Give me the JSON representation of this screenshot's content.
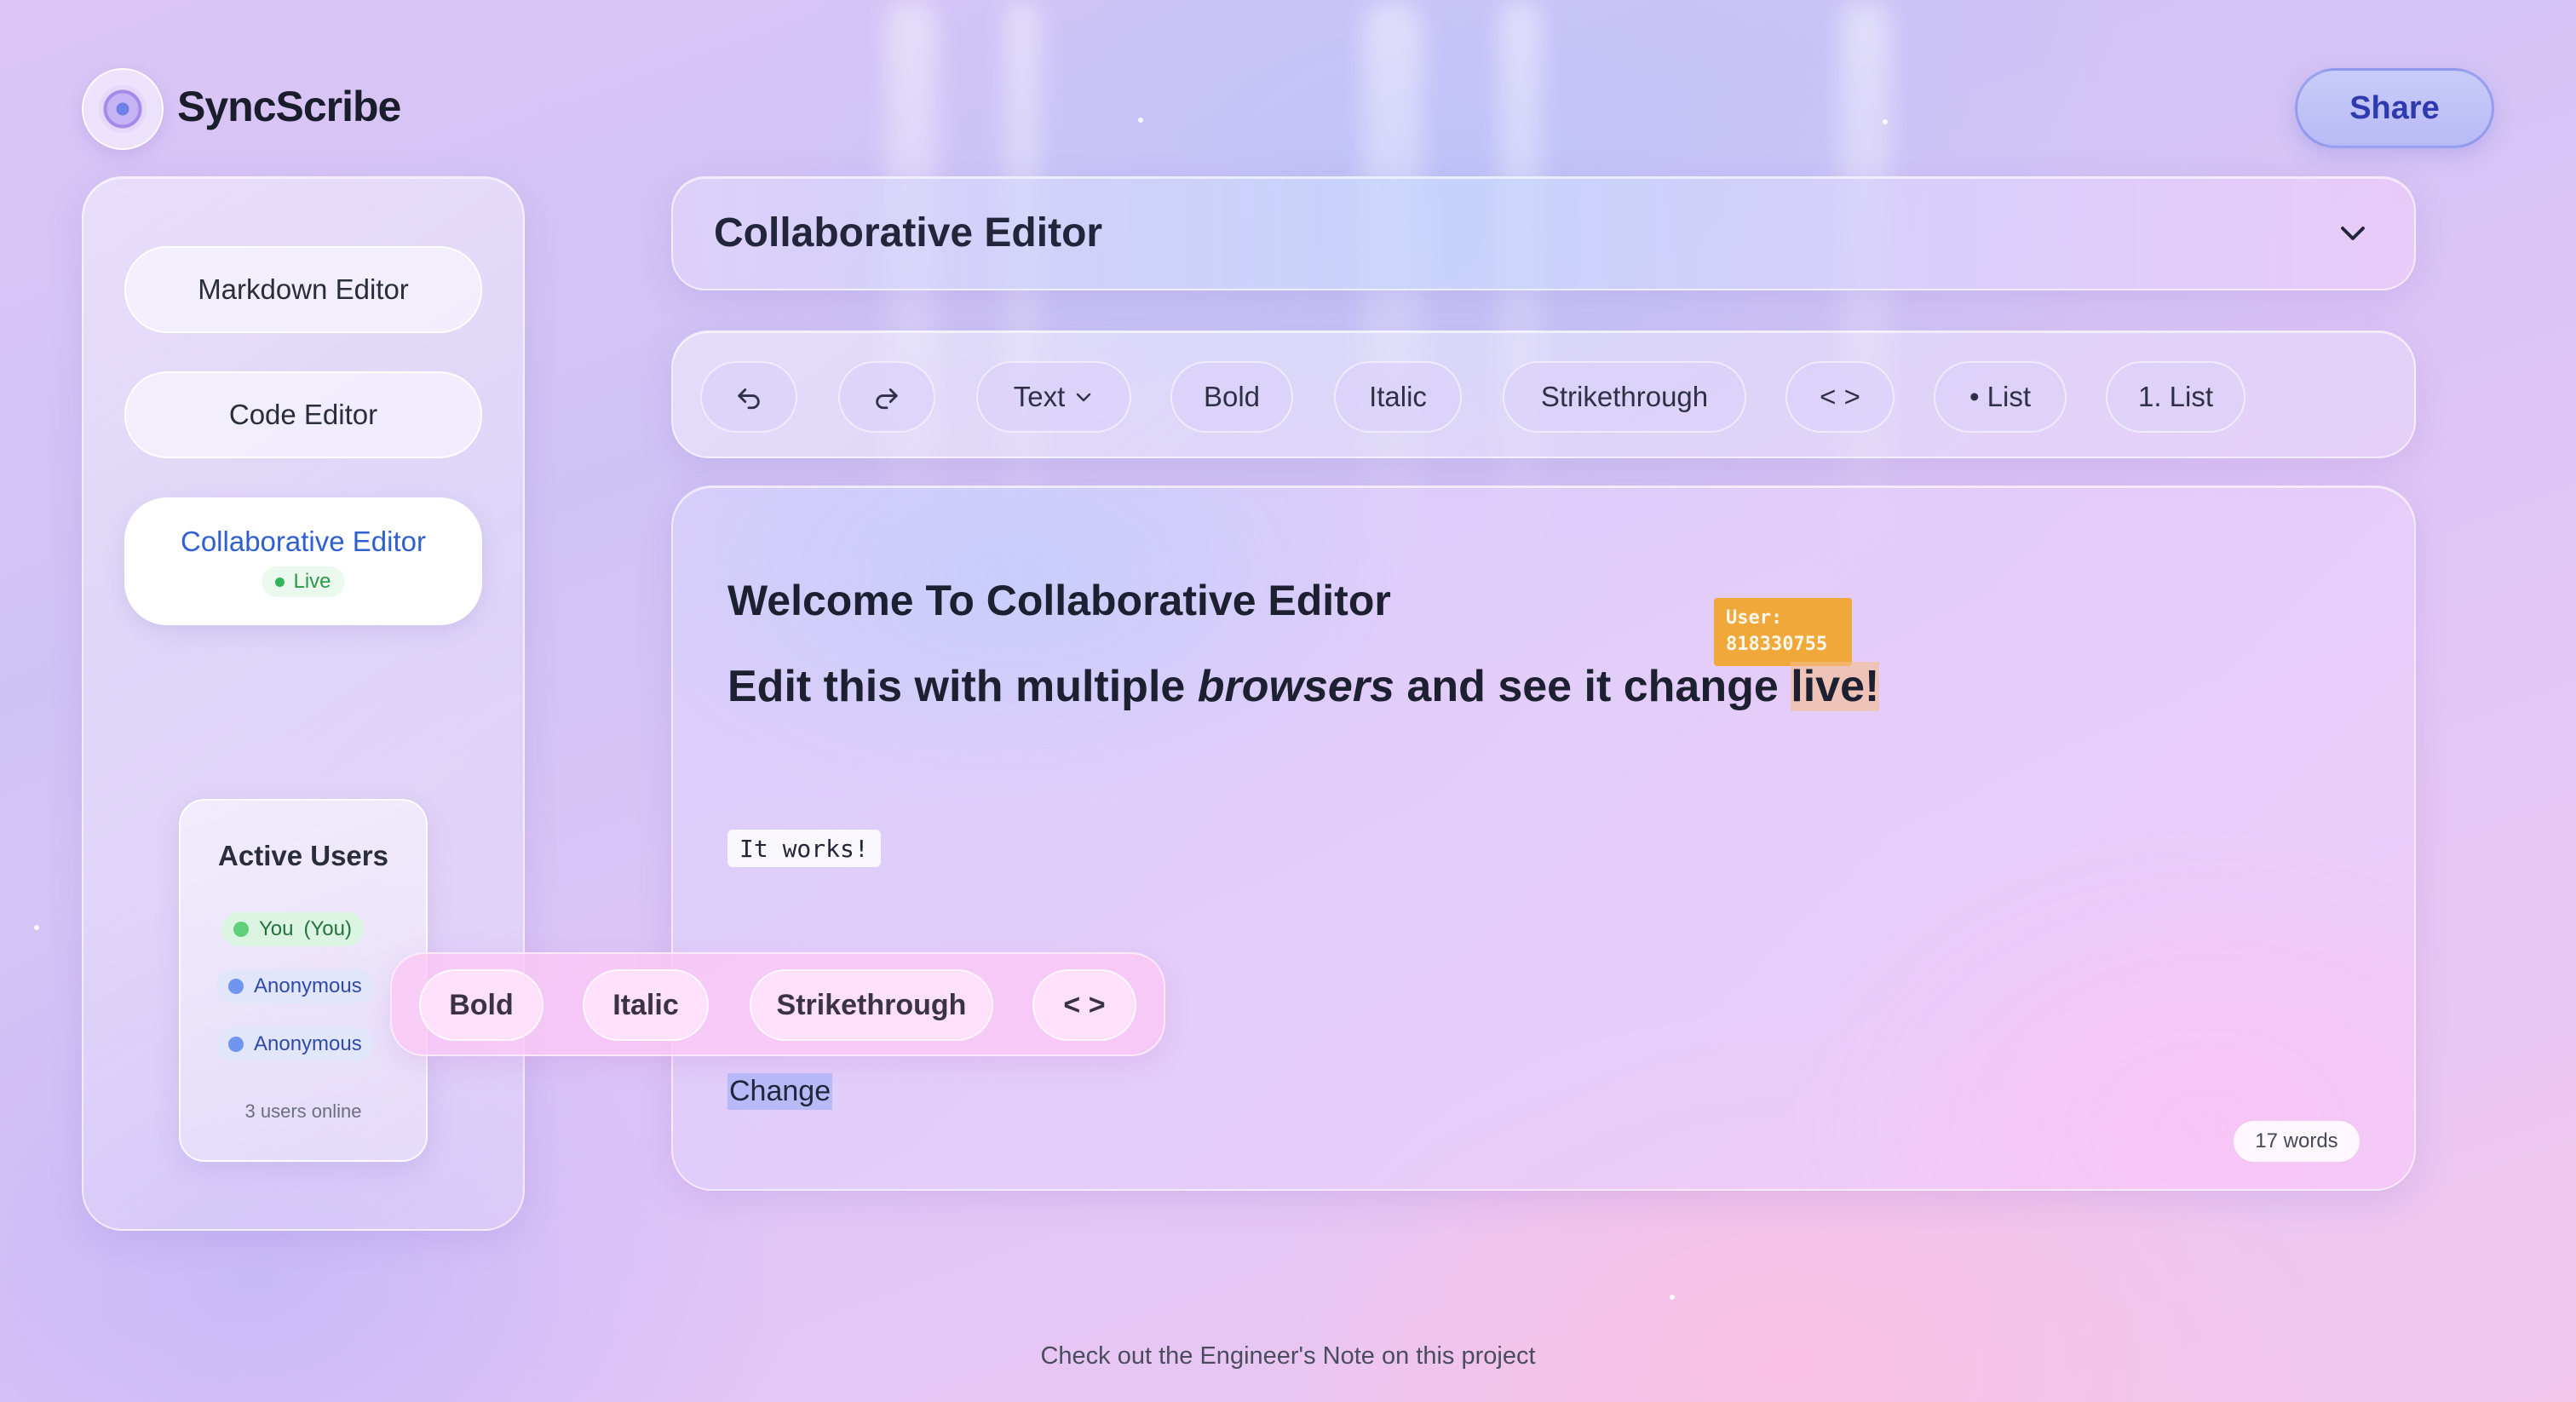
{
  "app": {
    "brand": "SyncScribe",
    "share_label": "Share"
  },
  "sidebar": {
    "items": [
      {
        "label": "Markdown Editor"
      },
      {
        "label": "Code Editor"
      },
      {
        "label": "Collaborative Editor",
        "badge": "Live",
        "active": true
      }
    ],
    "active_users": {
      "title": "Active Users",
      "users": [
        {
          "name": "You",
          "suffix": "(You)",
          "color": "#5fcf7a"
        },
        {
          "name": "Anonymous",
          "color": "#6f95ee"
        },
        {
          "name": "Anonymous",
          "color": "#6f95ee"
        }
      ],
      "footer": "3 users online"
    }
  },
  "main": {
    "title": "Collaborative Editor",
    "toolbar": {
      "undo_icon": "undo-icon",
      "redo_icon": "redo-icon",
      "text_label": "Text",
      "bold_label": "Bold",
      "italic_label": "Italic",
      "strike_label": "Strikethrough",
      "code_label": "< >",
      "bullet_label": "• List",
      "numbered_label": "1. List"
    },
    "editor": {
      "heading": "Welcome To Collaborative Editor",
      "para_before": "Edit this with multiple ",
      "para_italic": "browsers",
      "para_middle": " and see it change ",
      "para_highlight": "live!",
      "cursor_label_line1": "User:",
      "cursor_label_line2": "818330755",
      "code_text": "It works!",
      "selected_text": "Change",
      "word_count": "17 words"
    },
    "floating_toolbar": {
      "bold": "Bold",
      "italic": "Italic",
      "strike": "Strikethrough",
      "code": "< >"
    }
  },
  "footer": {
    "note": "Check out the Engineer's Note on this project"
  },
  "colors": {
    "accent": "#2f5fd0",
    "cursor_tag": "#f0a83a",
    "live": "#34b35a"
  }
}
